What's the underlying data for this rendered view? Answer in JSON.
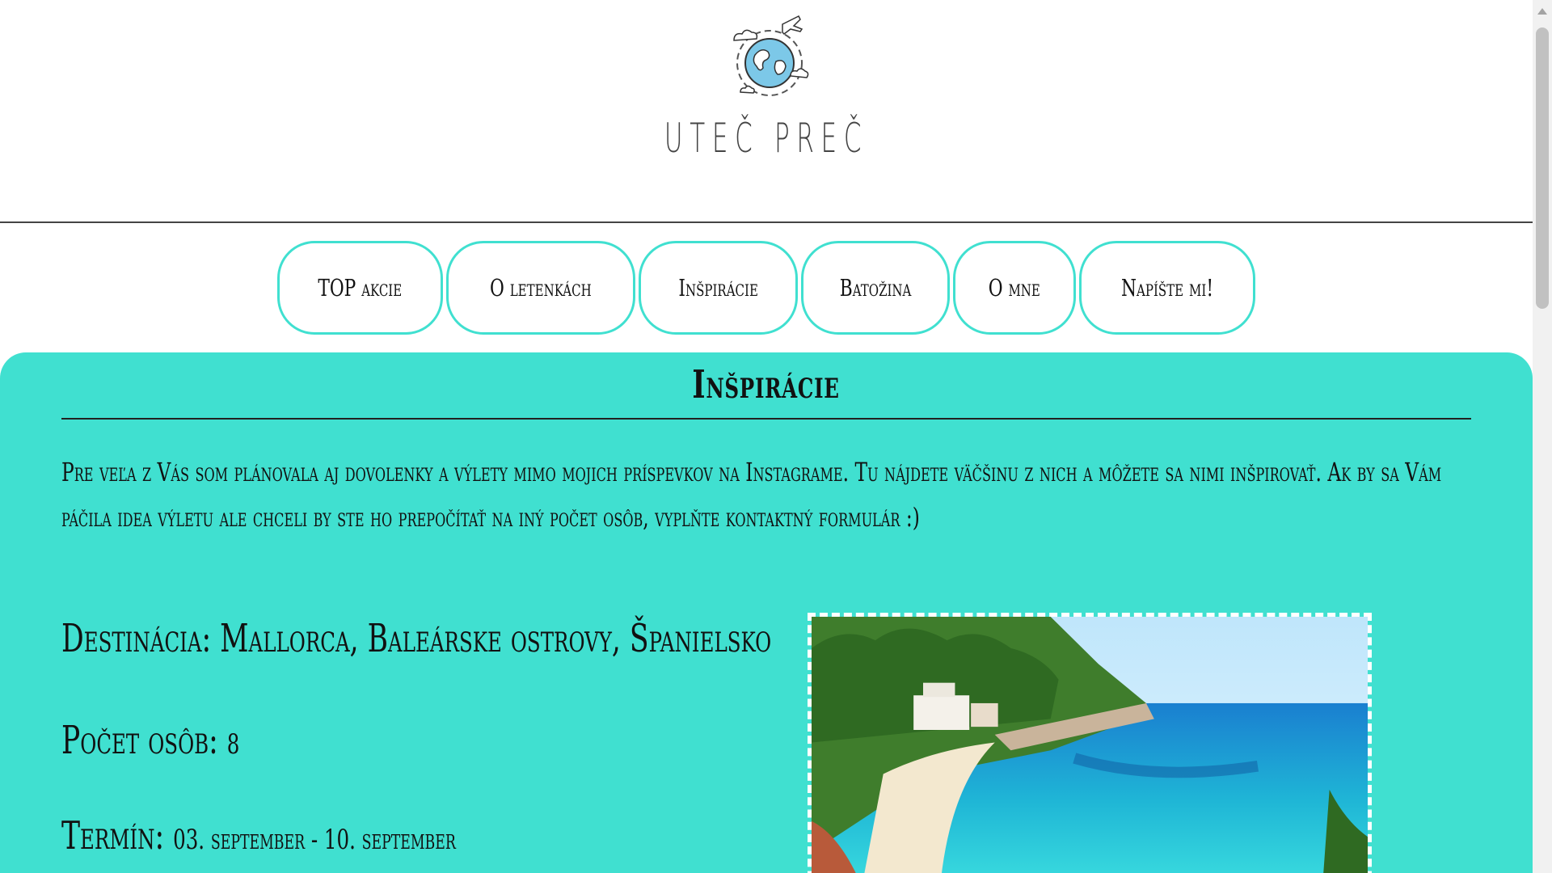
{
  "header": {
    "logo_icon": "globe-plane-icon",
    "site_title": "UTEČ PREČ"
  },
  "nav": {
    "items": [
      {
        "label": "TOP akcie"
      },
      {
        "label": "O letenkách"
      },
      {
        "label": "Inšpirácie"
      },
      {
        "label": "Batožina"
      },
      {
        "label": "O mne"
      },
      {
        "label": "Napíšte mi!"
      }
    ]
  },
  "main": {
    "title": "Inšpirácie",
    "intro": "Pre veľa z Vás som plánovala aj dovolenky a výlety mimo mojich príspevkov na Instagrame. Tu nájdete väčšinu z nich a môžete sa nimi inšpirovať. Ak by sa Vám páčila idea výletu ale chceli by ste ho prepočítať na iný počet osôb, vyplňte kontaktný formulár :)",
    "trip": {
      "destination_label": "Destinácia:",
      "destination_value": "Mallorca, Baleárske ostrovy, Španielsko",
      "persons_label": "Počet osôb:",
      "persons_value": "8",
      "date_label": "Termín:",
      "date_value": "03. september - 10. september",
      "photo_icon": "mallorca-beach-photo"
    }
  },
  "colors": {
    "accent": "#40e0d0",
    "text": "#111111",
    "background": "#ffffff"
  }
}
